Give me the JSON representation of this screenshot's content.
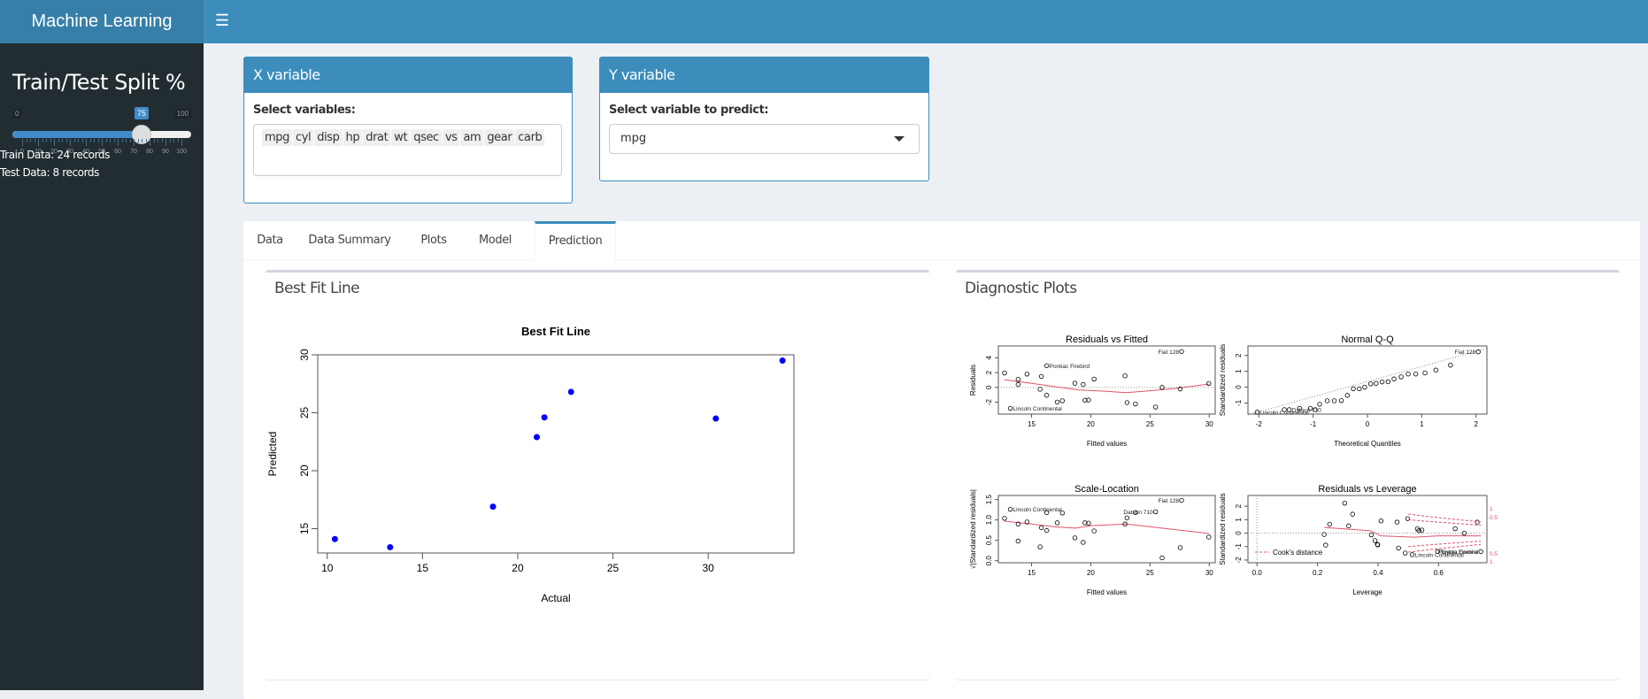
{
  "app": {
    "title": "Machine Learning",
    "menu_icon": "hamburger-icon"
  },
  "sidebar": {
    "heading": "Train/Test Split %",
    "slider": {
      "min": 0,
      "max": 100,
      "value": 75,
      "min_label": "0",
      "max_label": "100",
      "value_label": "75",
      "tick_labels": [
        "0",
        "10",
        "20",
        "30",
        "40",
        "50",
        "60",
        "70",
        "80",
        "90",
        "100"
      ],
      "fill_color": "#428bca"
    },
    "train_info": "Train Data: 24 records",
    "test_info": "Test Data: 8 records"
  },
  "x_box": {
    "title": "X variable",
    "label": "Select variables:",
    "selected": [
      "mpg",
      "cyl",
      "disp",
      "hp",
      "drat",
      "wt",
      "qsec",
      "vs",
      "am",
      "gear",
      "carb"
    ]
  },
  "y_box": {
    "title": "Y variable",
    "label": "Select variable to predict:",
    "value": "mpg"
  },
  "tabs": [
    {
      "label": "Data",
      "active": false
    },
    {
      "label": "Data Summary",
      "active": false
    },
    {
      "label": "Plots",
      "active": false
    },
    {
      "label": "Model",
      "active": false
    },
    {
      "label": "Prediction",
      "active": true
    }
  ],
  "panels": {
    "best_fit_title": "Best Fit Line",
    "diagnostic_title": "Diagnostic Plots"
  },
  "colors": {
    "header": "#3c8dbc",
    "logo_bg": "#367fa9",
    "sidebar_bg": "#222d32",
    "points": "#0000ff",
    "smooth_line": "#df536b",
    "cooks": "#df536b"
  },
  "chart_data": [
    {
      "type": "scatter",
      "title": "Best Fit Line",
      "xlabel": "Actual",
      "ylabel": "Predicted",
      "xlim": [
        9.5,
        34.5
      ],
      "ylim": [
        12.9,
        30
      ],
      "xticks": [
        10,
        15,
        20,
        25,
        30
      ],
      "yticks": [
        15,
        20,
        25,
        30
      ],
      "x": [
        10.4,
        13.3,
        18.7,
        21.0,
        21.4,
        22.8,
        30.4,
        33.9
      ],
      "y": [
        14.1,
        13.4,
        16.9,
        22.9,
        24.6,
        26.8,
        24.5,
        29.5
      ],
      "grid": false
    },
    {
      "type": "scatter",
      "title": "Residuals vs Fitted",
      "xlabel": "Fitted values",
      "ylabel": "Residuals",
      "xlim": [
        12.2,
        30.5
      ],
      "ylim": [
        -3.6,
        5.6
      ],
      "xticks": [
        15,
        20,
        25,
        30
      ],
      "yticks": [
        -2,
        0,
        2,
        4
      ],
      "x": [
        12.72,
        13.87,
        13.87,
        14.62,
        15.72,
        15.83,
        16.28,
        16.28,
        17.17,
        17.6,
        18.66,
        19.36,
        19.51,
        19.81,
        20.28,
        22.89,
        23.06,
        23.77,
        25.47,
        26.02,
        27.55,
        27.66,
        29.96,
        13.21
      ],
      "y": [
        1.95,
        1.1,
        0.39,
        1.8,
        -0.25,
        1.49,
        2.94,
        -1.06,
        -1.98,
        -1.8,
        0.57,
        0.39,
        -1.73,
        -1.7,
        1.13,
        1.56,
        -2.05,
        -2.23,
        -2.65,
        0.0,
        -0.21,
        4.85,
        0.53,
        -2.83
      ],
      "smooth": {
        "x": [
          12.72,
          15,
          17,
          19,
          21,
          23,
          25,
          27,
          29.96
        ],
        "y": [
          1.05,
          0.55,
          0.1,
          -0.35,
          -0.5,
          -0.7,
          -0.45,
          -0.15,
          0.45
        ]
      },
      "labels": [
        {
          "text": "Pontiac Firebird",
          "x": 16.28,
          "y": 2.94,
          "side": "right"
        },
        {
          "text": "Fiat 128",
          "x": 27.66,
          "y": 4.85,
          "side": "left"
        },
        {
          "text": "Lincoln Continental",
          "x": 13.21,
          "y": -2.83,
          "side": "right"
        }
      ]
    },
    {
      "type": "scatter",
      "title": "Normal Q-Q",
      "xlabel": "Theoretical Quantiles",
      "ylabel": "Standardized residuals",
      "xlim": [
        -2.2,
        2.2
      ],
      "ylim": [
        -1.7,
        2.6
      ],
      "xticks": [
        -2,
        -1,
        0,
        1,
        2
      ],
      "yticks": [
        -1,
        0,
        1,
        2
      ],
      "x": [
        -2.03,
        -1.53,
        -1.44,
        -1.25,
        -1.05,
        -0.96,
        -0.88,
        -0.74,
        -0.61,
        -0.48,
        -0.37,
        -0.26,
        -0.15,
        -0.05,
        0.06,
        0.16,
        0.27,
        0.38,
        0.49,
        0.62,
        0.75,
        0.89,
        1.06,
        1.26,
        1.53,
        2.04
      ],
      "y": [
        -1.58,
        -1.42,
        -1.42,
        -1.34,
        -1.34,
        -1.42,
        -1.08,
        -0.86,
        -0.86,
        -0.85,
        -0.52,
        -0.1,
        -0.1,
        0.0,
        0.21,
        0.24,
        0.33,
        0.34,
        0.52,
        0.65,
        0.83,
        0.83,
        0.9,
        1.08,
        1.39,
        2.23
      ],
      "refline": {
        "x": [
          -2.2,
          2.2
        ],
        "y": [
          -1.75,
          2.45
        ]
      },
      "labels": [
        {
          "text": "Fiat 128",
          "x": 2.04,
          "y": 2.23,
          "side": "left"
        },
        {
          "text": "Lincoln Continental",
          "x": -2.03,
          "y": -1.58,
          "side": "right"
        },
        {
          "text": "Datsun 710",
          "x": -1.44,
          "y": -1.42,
          "side": "right"
        }
      ]
    },
    {
      "type": "scatter",
      "title": "Scale-Location",
      "xlabel": "Fitted values",
      "ylabel": "√|Standardized residuals|",
      "xlim": [
        12.2,
        30.5
      ],
      "ylim": [
        -0.05,
        1.6
      ],
      "xticks": [
        15,
        20,
        25,
        30
      ],
      "yticks": [
        0.0,
        0.5,
        1.0,
        1.5
      ],
      "x": [
        12.72,
        13.87,
        13.87,
        14.62,
        15.72,
        15.83,
        16.28,
        16.28,
        17.17,
        17.6,
        18.66,
        19.36,
        19.51,
        19.81,
        20.28,
        22.89,
        23.06,
        23.77,
        25.47,
        26.02,
        27.55,
        27.66,
        29.96,
        13.21
      ],
      "y": [
        1.04,
        0.9,
        0.48,
        0.95,
        0.34,
        0.81,
        1.18,
        0.74,
        0.93,
        1.17,
        0.56,
        0.45,
        0.93,
        0.92,
        0.73,
        0.9,
        1.05,
        1.18,
        1.2,
        0.07,
        0.32,
        1.48,
        0.58,
        1.26
      ],
      "smooth": {
        "x": [
          12.72,
          15,
          17,
          18.7,
          20,
          23,
          26,
          29.96
        ],
        "y": [
          0.97,
          0.9,
          0.83,
          0.8,
          0.86,
          0.9,
          0.8,
          0.67
        ]
      },
      "labels": [
        {
          "text": "Lincoln Continental",
          "x": 13.21,
          "y": 1.26,
          "side": "right"
        },
        {
          "text": "Datsun 710",
          "x": 25.47,
          "y": 1.2,
          "side": "left"
        },
        {
          "text": "Fiat 128",
          "x": 27.66,
          "y": 1.48,
          "side": "left"
        }
      ]
    },
    {
      "type": "scatter",
      "title": "Residuals vs Leverage",
      "xlabel": "Leverage",
      "ylabel": "Standardized residuals",
      "xlim": [
        -0.03,
        0.76
      ],
      "ylim": [
        -2.2,
        2.8
      ],
      "xticks": [
        0.0,
        0.2,
        0.4,
        0.6
      ],
      "yticks": [
        -2,
        -1,
        0,
        1,
        2
      ],
      "x": [
        0.222,
        0.227,
        0.24,
        0.29,
        0.303,
        0.316,
        0.378,
        0.39,
        0.398,
        0.399,
        0.41,
        0.463,
        0.468,
        0.49,
        0.498,
        0.513,
        0.53,
        0.535,
        0.545,
        0.597,
        0.655,
        0.685,
        0.728,
        0.74
      ],
      "y": [
        -0.1,
        -0.89,
        0.66,
        2.23,
        0.54,
        1.41,
        -0.13,
        -0.55,
        -0.84,
        -0.87,
        0.91,
        0.82,
        -1.11,
        -1.48,
        1.08,
        -1.6,
        0.32,
        0.19,
        0.23,
        -1.37,
        0.33,
        0.0,
        0.82,
        -1.37
      ],
      "smooth": {
        "x": [
          0.222,
          0.3,
          0.375,
          0.41,
          0.52,
          0.6,
          0.74
        ],
        "y": [
          0.42,
          0.3,
          0.18,
          -0.2,
          -0.3,
          -0.2,
          -0.2
        ]
      },
      "labels": [
        {
          "text": "Lincoln Continental",
          "x": 0.513,
          "y": -1.6,
          "side": "right"
        },
        {
          "text": "Toyota Corona",
          "x": 0.597,
          "y": -1.37,
          "side": "right"
        },
        {
          "text": "Pontiac Firebird",
          "x": 0.74,
          "y": -1.37,
          "side": "left"
        }
      ],
      "legend": "Cook's distance",
      "legend_position": "bottom-left",
      "cooks_labels": [
        "1",
        "0.5",
        "0.5",
        "1"
      ]
    }
  ]
}
